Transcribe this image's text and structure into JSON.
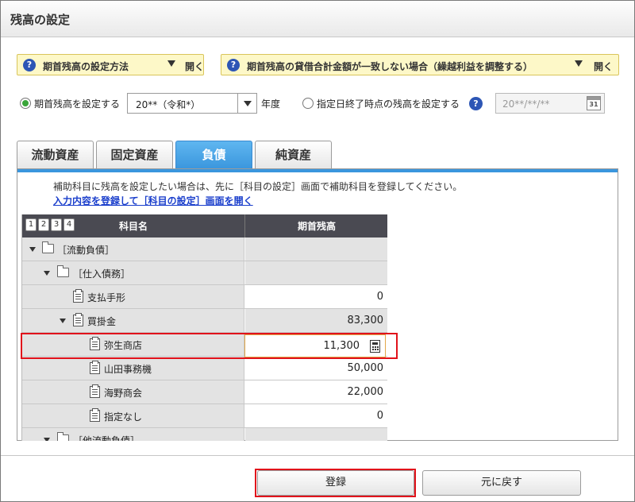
{
  "window": {
    "title": "残高の設定"
  },
  "help": {
    "left": {
      "text": "期首残高の設定方法",
      "open": "開く"
    },
    "right": {
      "text": "期首残高の貸借合計金額が一致しない場合（繰越利益を調整する）",
      "open": "開く"
    },
    "q_glyph": "?"
  },
  "options": {
    "set_opening": {
      "label": "期首残高を設定する",
      "selected": true
    },
    "year_select": {
      "value": "20**（令和*）"
    },
    "year_suffix": "年度",
    "set_date": {
      "label": "指定日終了時点の残高を設定する",
      "selected": false
    },
    "date_placeholder": "20**/**/**",
    "cal_num": "31"
  },
  "tabs": [
    {
      "label": "流動資産",
      "active": false
    },
    {
      "label": "固定資産",
      "active": false
    },
    {
      "label": "負債",
      "active": true
    },
    {
      "label": "純資産",
      "active": false
    }
  ],
  "notice": {
    "text": "補助科目に残高を設定したい場合は、先に［科目の設定］画面で補助科目を登録してください。",
    "link": "入力内容を登録して［科目の設定］画面を開く"
  },
  "grid": {
    "levels": [
      "1",
      "2",
      "3",
      "4"
    ],
    "col_name": "科目名",
    "col_value": "期首残高",
    "rows": [
      {
        "name": "［流動負債］",
        "value": ""
      },
      {
        "name": "［仕入債務］",
        "value": ""
      },
      {
        "name": "支払手形",
        "value": "0"
      },
      {
        "name": "買掛金",
        "value": "83,300"
      },
      {
        "name": "弥生商店",
        "value": "11,300"
      },
      {
        "name": "山田事務機",
        "value": "50,000"
      },
      {
        "name": "海野商会",
        "value": "22,000"
      },
      {
        "name": "指定なし",
        "value": "0"
      },
      {
        "name": "［他流動負債］",
        "value": ""
      }
    ]
  },
  "buttons": {
    "register": "登録",
    "revert": "元に戻す"
  }
}
